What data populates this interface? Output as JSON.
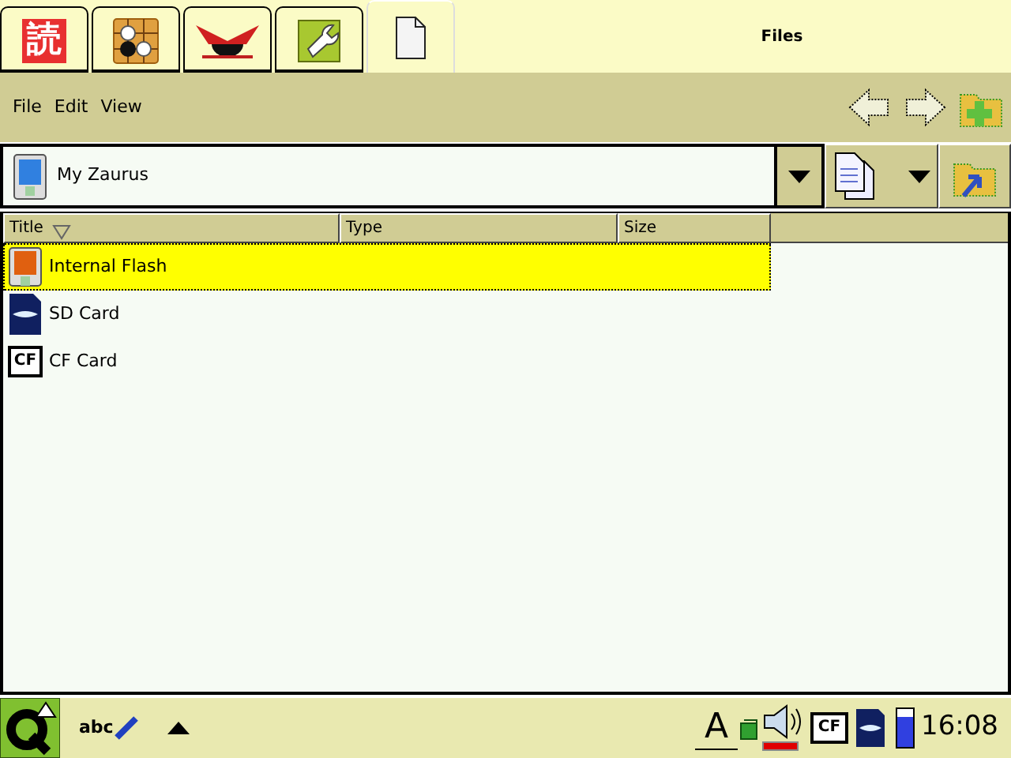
{
  "tabs": [
    {
      "kind": "reader",
      "glyph": "読",
      "selected": false
    },
    {
      "kind": "board",
      "selected": false
    },
    {
      "kind": "emblem",
      "selected": false
    },
    {
      "kind": "wrench",
      "selected": false
    },
    {
      "kind": "document",
      "selected": true
    }
  ],
  "window": {
    "title": "Files"
  },
  "menu": [
    "File",
    "Edit",
    "View"
  ],
  "location": {
    "value": "My Zaurus"
  },
  "table": {
    "columns": [
      {
        "label": "Title",
        "sorted": true
      },
      {
        "label": "Type",
        "sorted": false
      },
      {
        "label": "Size",
        "sorted": false
      }
    ],
    "rows": [
      {
        "kind": "flash",
        "title": "Internal Flash",
        "selected": true
      },
      {
        "kind": "sd",
        "title": "SD Card",
        "selected": false
      },
      {
        "kind": "cf",
        "title": "CF Card",
        "badge": "CF",
        "selected": false
      }
    ]
  },
  "taskbar": {
    "input_label": "abc",
    "font_glyph": "A",
    "cf_badge": "CF",
    "battery": {
      "level": 0.8
    },
    "clock": "16:08"
  }
}
